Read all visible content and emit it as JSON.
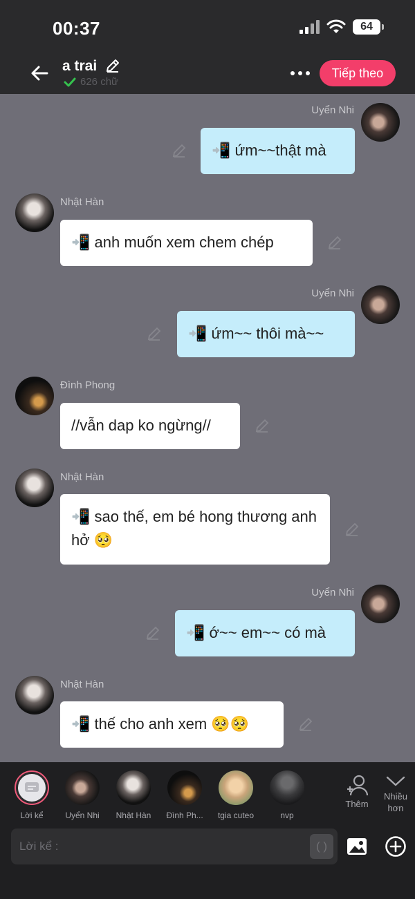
{
  "status": {
    "time": "00:37",
    "battery": "64"
  },
  "header": {
    "title": "a trai",
    "word_count": "626 chữ",
    "next_label": "Tiếp theo"
  },
  "colors": {
    "accent": "#f33e6a",
    "bubble_right": "#c5edfb",
    "bubble_left": "#ffffff",
    "check": "#35c24e"
  },
  "messages": [
    {
      "sender": "Uyển Nhi",
      "side": "right",
      "text": "📲 ứm~~thật mà"
    },
    {
      "sender": "Nhật Hàn",
      "side": "left",
      "text": "📲 anh muốn xem chem chép"
    },
    {
      "sender": "Uyển Nhi",
      "side": "right",
      "text": "📲 ứm~~ thôi mà~~"
    },
    {
      "sender": "Đình Phong",
      "side": "left",
      "text": "//vẫn dap ko ngừng//"
    },
    {
      "sender": "Nhật Hàn",
      "side": "left",
      "text": "📲 sao thế, em bé hong thương anh hở 🥺"
    },
    {
      "sender": "Uyển Nhi",
      "side": "right",
      "text": "📲 ớ~~ em~~ có mà"
    },
    {
      "sender": "Nhật Hàn",
      "side": "left",
      "text": "📲 thế cho anh xem 🥺🥺"
    }
  ],
  "characters": [
    {
      "label": "Lời kể",
      "icon": "narration-icon"
    },
    {
      "label": "Uyển Nhi",
      "icon": "avatar"
    },
    {
      "label": "Nhật Hàn",
      "icon": "avatar"
    },
    {
      "label": "Đình Ph...",
      "icon": "avatar"
    },
    {
      "label": "tgia cuteo",
      "icon": "avatar"
    },
    {
      "label": "nvp",
      "icon": "avatar"
    }
  ],
  "tools": {
    "add_label": "Thêm",
    "more_label": "Nhiều hơn"
  },
  "input": {
    "placeholder": "Lời kể :",
    "bracket": "( )"
  }
}
